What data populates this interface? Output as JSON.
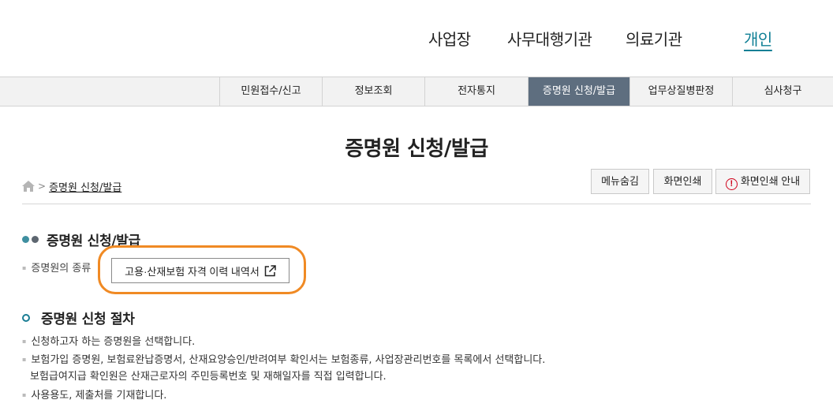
{
  "top_nav": {
    "items": [
      {
        "label": "사업장"
      },
      {
        "label": "사무대행기관"
      },
      {
        "label": "의료기관"
      },
      {
        "label": "개인",
        "active": true
      }
    ],
    "active_color": "#0f7f95"
  },
  "menu": {
    "items": [
      {
        "label": "민원접수/신고"
      },
      {
        "label": "정보조회"
      },
      {
        "label": "전자통지"
      },
      {
        "label": "증명원 신청/발급",
        "active": true
      },
      {
        "label": "업무상질병판정"
      },
      {
        "label": "심사청구"
      }
    ],
    "active_bg": "#5e6e7f"
  },
  "page": {
    "title": "증명원 신청/발급"
  },
  "breadcrumb": {
    "home_icon": "home-icon",
    "current": "증명원 신청/발급"
  },
  "toolbar": {
    "hide_menu": "메뉴숨김",
    "print": "화면인쇄",
    "print_guide": "화면인쇄 안내"
  },
  "section1": {
    "title": "증명원 신청/발급",
    "type_label": "증명원의 종류",
    "cert_button": "고용·산재보험 자격 이력 내역서",
    "highlight_color": "#f08a24"
  },
  "section2": {
    "title": "증명원 신청 절차",
    "lines": [
      "신청하고자 하는 증명원을 선택합니다.",
      "보험가입 증명원, 보험료완납증명서, 산재요양승인/반려여부 확인서는 보험종류, 사업장관리번호를 목록에서 선택합니다.",
      "보험급여지급 확인원은 산재근로자의 주민등록번호 및 재해일자를 직접 입력합니다.",
      "사용용도, 제출처를 기재합니다."
    ]
  }
}
